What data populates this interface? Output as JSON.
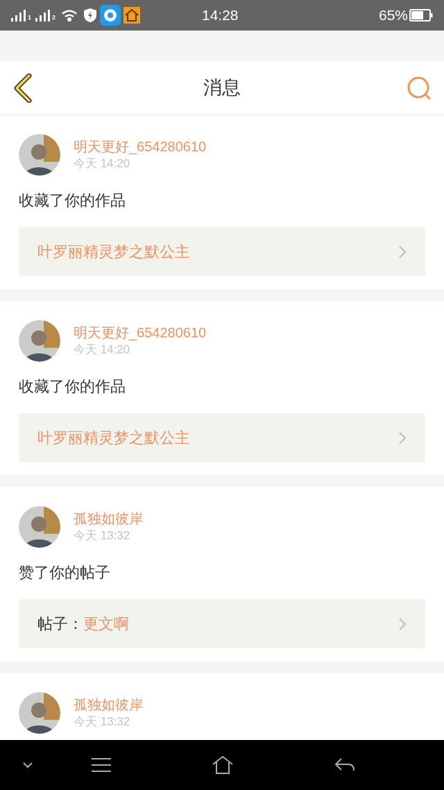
{
  "status_bar": {
    "sim_labels": [
      "1",
      "2"
    ],
    "time": "14:28",
    "battery": "65%"
  },
  "header": {
    "title": "消息"
  },
  "messages": [
    {
      "user": "明天更好_654280610",
      "time": "今天 14:20",
      "action": "收藏了你的作品",
      "link": {
        "kind": "work",
        "title": "叶罗丽精灵梦之默公主"
      }
    },
    {
      "user": "明天更好_654280610",
      "time": "今天 14:20",
      "action": "收藏了你的作品",
      "link": {
        "kind": "work",
        "title": "叶罗丽精灵梦之默公主"
      }
    },
    {
      "user": "孤独如彼岸",
      "time": "今天 13:32",
      "action": "赞了你的帖子",
      "link": {
        "kind": "post",
        "prefix": "帖子：",
        "title": "更文啊"
      }
    },
    {
      "user": "孤独如彼岸",
      "time": "今天 13:32"
    }
  ]
}
